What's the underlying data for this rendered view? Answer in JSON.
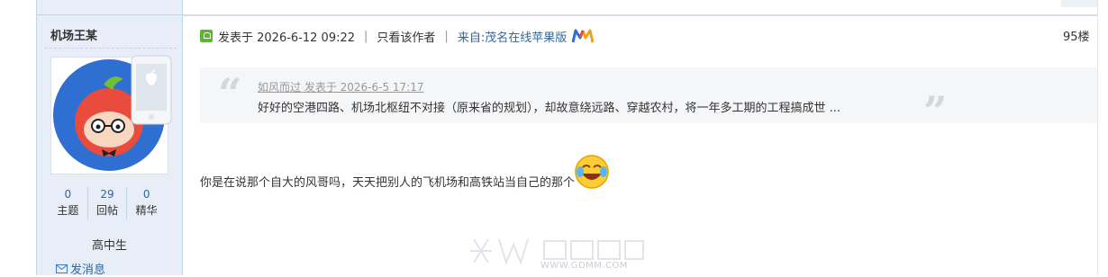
{
  "author": {
    "name": "机场王某",
    "user_group": "高中生",
    "send_message_label": "发消息",
    "stats": [
      {
        "value": "0",
        "label": "主题"
      },
      {
        "value": "29",
        "label": "回帖"
      },
      {
        "value": "0",
        "label": "精华"
      }
    ]
  },
  "post": {
    "posted_label": "发表于 2026-6-12 09:22",
    "only_author_label": "只看该作者",
    "from_label": "来自:茂名在线苹果版",
    "floor": "95楼",
    "body_text": "你是在说那个自大的风哥吗，天天把别人的飞机场和高铁站当自己的那个"
  },
  "quote": {
    "meta": "如风而过 发表于 2026-6-5 17:17",
    "text": "好好的空港四路、机场北枢纽不对接（原来省的规划），却故意绕远路、穿越农村，将一年多工期的工程搞成世 ..."
  },
  "watermark": {
    "url": "WWW.GDMM.COM"
  },
  "colors": {
    "sidebar_bg": "#e8eef7",
    "link": "#336699",
    "quote_bg": "#f5f6f8"
  }
}
